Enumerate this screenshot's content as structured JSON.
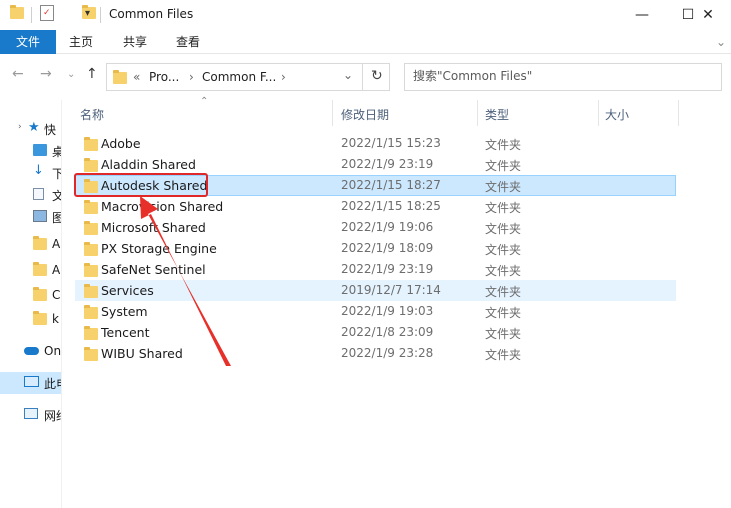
{
  "window": {
    "title": "Common Files",
    "minimize": "—",
    "maximize": "☐",
    "close": "✕"
  },
  "ribbon": {
    "tabs": [
      {
        "label": "文件"
      },
      {
        "label": "主页"
      },
      {
        "label": "共享"
      },
      {
        "label": "查看"
      }
    ],
    "expand": "⌄"
  },
  "address": {
    "prefix": "«",
    "segment1": "Pro...",
    "segment2": "Common F...",
    "sep": "›",
    "dropdown": "⌄",
    "refresh": "↻"
  },
  "search": {
    "placeholder": "搜索\"Common Files\""
  },
  "navpane": {
    "items": [
      {
        "label": "快",
        "icon": "star-icon"
      },
      {
        "label": "桌",
        "icon": "desktop-icon"
      },
      {
        "label": "下",
        "icon": "download-icon"
      },
      {
        "label": "文",
        "icon": "document-icon"
      },
      {
        "label": "图",
        "icon": "picture-icon"
      },
      {
        "label": "A",
        "icon": "folder-icon"
      },
      {
        "label": "A",
        "icon": "folder-icon"
      },
      {
        "label": "C",
        "icon": "folder-icon"
      },
      {
        "label": "k",
        "icon": "folder-icon"
      },
      {
        "label": "On",
        "icon": "cloud-icon"
      },
      {
        "label": "此电",
        "icon": "computer-icon"
      },
      {
        "label": "网络",
        "icon": "network-icon"
      }
    ]
  },
  "columns": {
    "name": "名称",
    "modified": "修改日期",
    "type": "类型",
    "size": "大小"
  },
  "files": [
    {
      "name": "Adobe",
      "date": "2022/1/15 15:23",
      "type": "文件夹"
    },
    {
      "name": "Aladdin Shared",
      "date": "2022/1/9 23:19",
      "type": "文件夹"
    },
    {
      "name": "Autodesk Shared",
      "date": "2022/1/15 18:27",
      "type": "文件夹"
    },
    {
      "name": "Macrovision Shared",
      "date": "2022/1/15 18:25",
      "type": "文件夹"
    },
    {
      "name": "Microsoft Shared",
      "date": "2022/1/9 19:06",
      "type": "文件夹"
    },
    {
      "name": "PX Storage Engine",
      "date": "2022/1/9 18:09",
      "type": "文件夹"
    },
    {
      "name": "SafeNet Sentinel",
      "date": "2022/1/9 23:19",
      "type": "文件夹"
    },
    {
      "name": "Services",
      "date": "2019/12/7 17:14",
      "type": "文件夹"
    },
    {
      "name": "System",
      "date": "2022/1/9 19:03",
      "type": "文件夹"
    },
    {
      "name": "Tencent",
      "date": "2022/1/8 23:09",
      "type": "文件夹"
    },
    {
      "name": "WIBU Shared",
      "date": "2022/1/9 23:28",
      "type": "文件夹"
    }
  ],
  "colors": {
    "accent": "#1979ca",
    "selection": "#cce8ff",
    "annotation": "#e02828",
    "folder": "#f7d16b"
  }
}
